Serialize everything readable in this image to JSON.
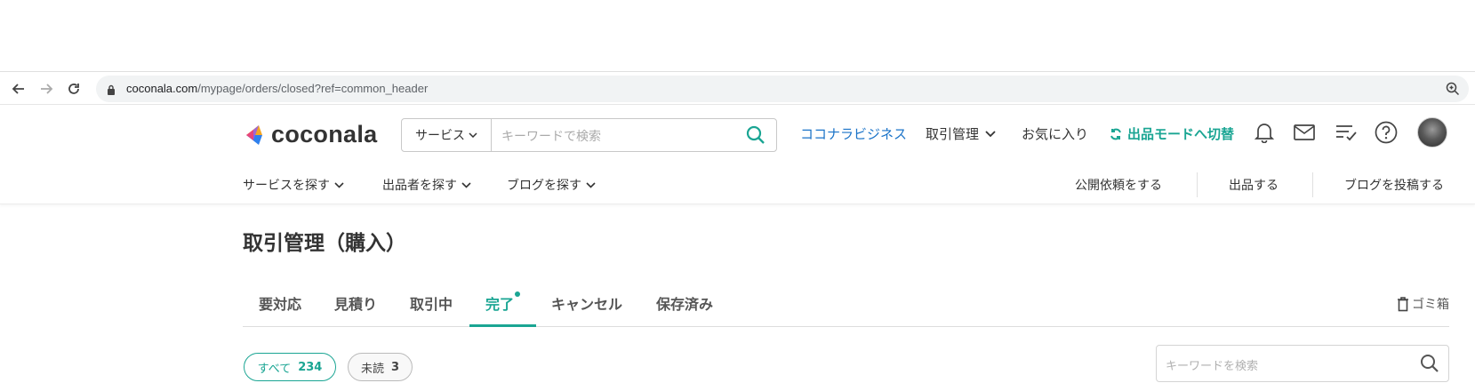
{
  "browser": {
    "url_host": "coconala.com",
    "url_path": "/mypage/orders/closed?ref=common_header"
  },
  "header": {
    "logo_text": "coconala",
    "search_category": "サービス",
    "search_placeholder": "キーワードで検索",
    "nav_business": "ココナラビジネス",
    "nav_trade": "取引管理",
    "nav_favorites": "お気に入り",
    "nav_switch_mode": "出品モードへ切替"
  },
  "subnav": {
    "find_services": "サービスを探す",
    "find_sellers": "出品者を探す",
    "find_blogs": "ブログを探す",
    "public_request": "公開依頼をする",
    "sell": "出品する",
    "post_blog": "ブログを投稿する"
  },
  "page": {
    "title": "取引管理（購入）"
  },
  "tabs": [
    {
      "label": "要対応"
    },
    {
      "label": "見積り"
    },
    {
      "label": "取引中"
    },
    {
      "label": "完了"
    },
    {
      "label": "キャンセル"
    },
    {
      "label": "保存済み"
    }
  ],
  "trash_label": "ゴミ箱",
  "filters": {
    "all_label": "すべて",
    "all_count": "234",
    "unread_label": "未読",
    "unread_count": "3"
  },
  "keyword_search_placeholder": "キーワードを検索",
  "colors": {
    "accent": "#1aa593",
    "link_blue": "#1a73c8"
  }
}
